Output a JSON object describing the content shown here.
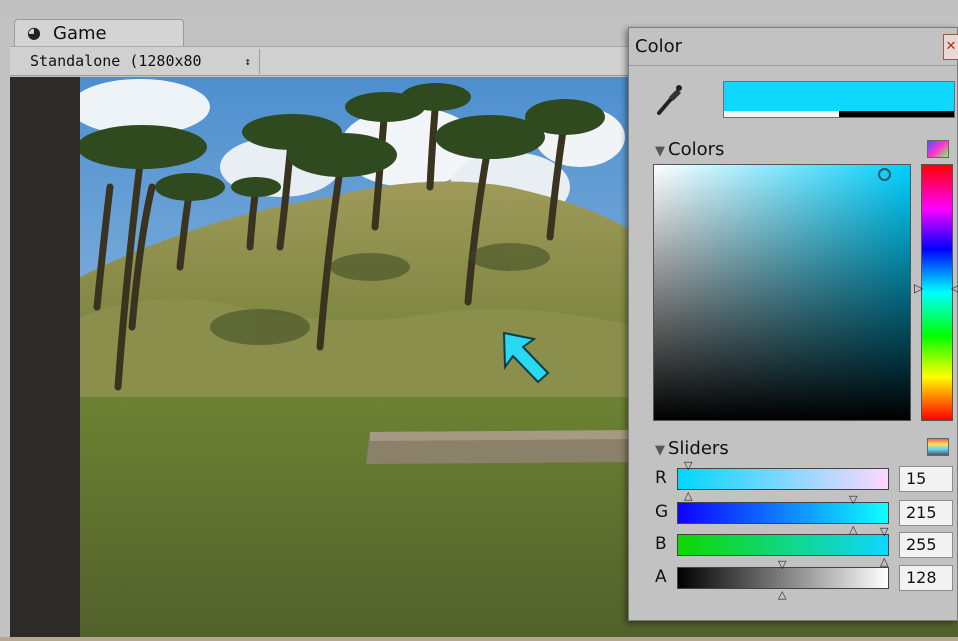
{
  "game": {
    "tab_icon": "unity-game-icon",
    "tab_label": "Game",
    "resolution": "Standalone (1280x80",
    "resolution_arrow": "↕"
  },
  "color_picker": {
    "title": "Color",
    "close_glyph": "✕",
    "current_color": "#0fd7ff",
    "alpha_fraction": 0.5,
    "colors_label": "Colors",
    "sliders_label": "Sliders",
    "collapse_glyph": "▼",
    "sliders": [
      {
        "channel": "R",
        "value": "15"
      },
      {
        "channel": "G",
        "value": "215"
      },
      {
        "channel": "B",
        "value": "255"
      },
      {
        "channel": "A",
        "value": "128"
      }
    ]
  },
  "colors": {
    "cursor_arrow": "#29d9f0",
    "sky": "#7fb1dc",
    "hill": "#7a8a3e",
    "ground": "#5f7a2c"
  }
}
